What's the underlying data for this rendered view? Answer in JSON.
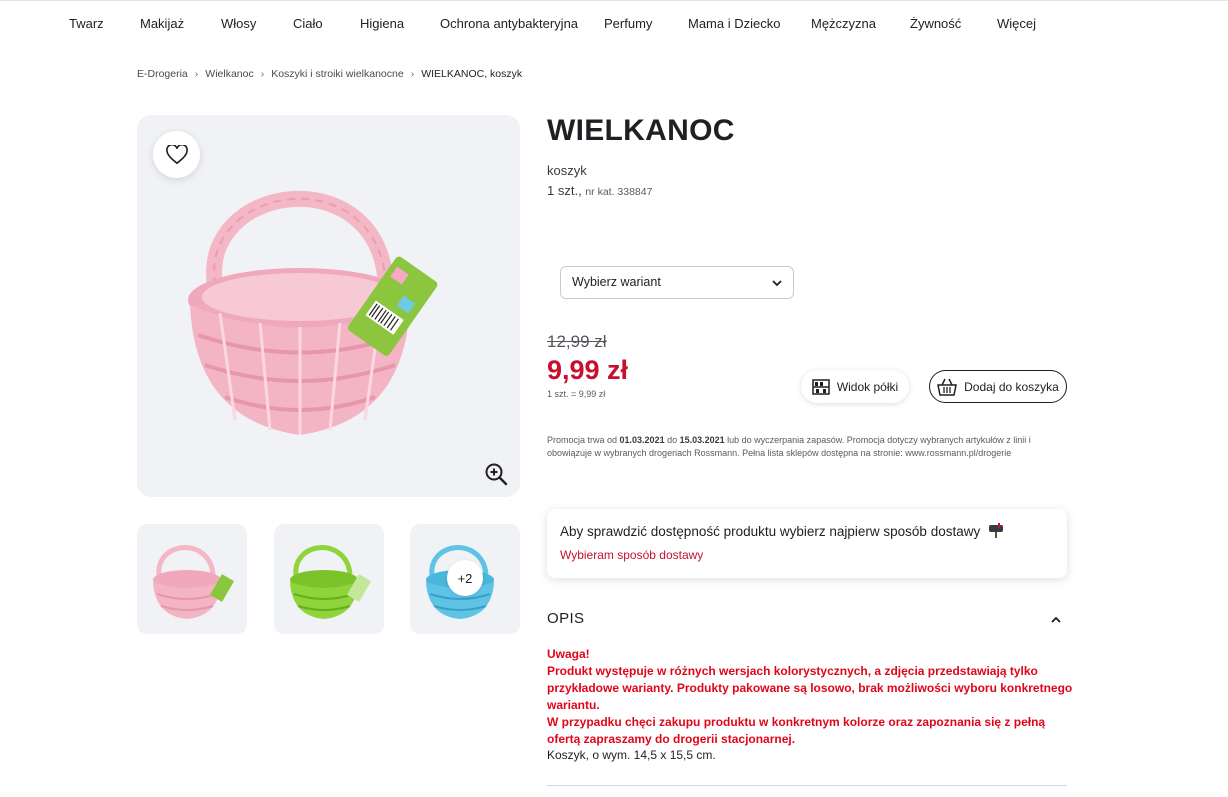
{
  "nav": {
    "items": [
      "Twarz",
      "Makijaż",
      "Włosy",
      "Ciało",
      "Higiena",
      "Ochrona antybakteryjna",
      "Perfumy",
      "Mama i Dziecko",
      "Mężczyzna",
      "Żywność",
      "Więcej"
    ]
  },
  "breadcrumb": {
    "items": [
      "E-Drogeria",
      "Wielkanoc",
      "Koszyki i stroiki wielkanocne"
    ],
    "current": "WIELKANOC, koszyk"
  },
  "gallery": {
    "main_icon": "basket-image",
    "thumbnails": [
      {
        "color": "pink",
        "icon": "pink-basket"
      },
      {
        "color": "green",
        "icon": "green-basket"
      },
      {
        "color": "blue",
        "icon": "blue-basket"
      }
    ],
    "more_label": "+2"
  },
  "product": {
    "title": "WIELKANOC",
    "subtitle": "koszyk",
    "quantity": "1 szt.,",
    "catalog": "nr kat. 338847"
  },
  "variant": {
    "label": "Wybierz wariant"
  },
  "price": {
    "old": "12,99 zł",
    "current": "9,99 zł",
    "unit": "1 szt. = 9,99 zł",
    "color": "#c8102e"
  },
  "actions": {
    "shelf_label": "Widok półki",
    "cart_label": "Dodaj do koszyka"
  },
  "promo": {
    "p1": "Promocja trwa od ",
    "date_from": "01.03.2021",
    "p2": " do ",
    "date_to": "15.03.2021",
    "p3": " lub do wyczerpania zapasów. Promocja dotyczy wybranych artykułów z linii i obowiązuje w wybranych drogeriach Rossmann. Pełna lista sklepów dostępna na stronie: www.rossmann.pl/drogerie"
  },
  "delivery": {
    "question": "Aby sprawdzić dostępność produktu wybierz najpierw sposób dostawy",
    "link": "Wybieram sposób dostawy"
  },
  "description": {
    "heading": "OPIS",
    "warning_lines": [
      "Uwaga!",
      "Produkt występuje w różnych wersjach kolorystycznych, a zdjęcia przedstawiają tylko przykładowe warianty. Produkty pakowane są losowo, brak możliwości wyboru konkretnego wariantu.",
      "W przypadku chęci zakupu produktu w konkretnym kolorze oraz zapoznania się z pełną ofertą zapraszamy do drogerii stacjonarnej."
    ],
    "size": "Koszyk, o wym. 14,5 x 15,5 cm.",
    "warning_color": "#e0061a"
  }
}
